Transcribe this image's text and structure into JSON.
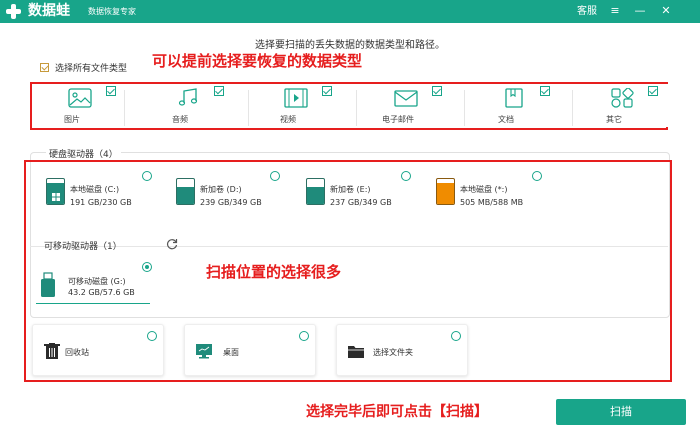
{
  "titlebar": {
    "app_name": "数据蛙",
    "subtitle": "数据恢复专家",
    "support": "客服",
    "menu_icon": "≡",
    "minimize_icon": "—",
    "close_icon": "✕",
    "color": "#18a58a"
  },
  "instruction": "选择要扫描的丢失数据的数据类型和路径。",
  "select_all": {
    "label": "选择所有文件类型",
    "checked": true
  },
  "annotations": {
    "types_hint": "可以提前选择要恢复的数据类型",
    "locations_hint": "扫描位置的选择很多",
    "scan_hint": "选择完毕后即可点击【扫描】",
    "color": "#e61e1e"
  },
  "file_types": [
    {
      "label": "图片",
      "icon": "image-icon",
      "checked": true
    },
    {
      "label": "音频",
      "icon": "music-icon",
      "checked": true
    },
    {
      "label": "视频",
      "icon": "video-icon",
      "checked": true
    },
    {
      "label": "电子邮件",
      "icon": "email-icon",
      "checked": true
    },
    {
      "label": "文档",
      "icon": "document-icon",
      "checked": true
    },
    {
      "label": "其它",
      "icon": "other-icon",
      "checked": true
    }
  ],
  "hard_drives": {
    "title": "硬盘驱动器（4）",
    "items": [
      {
        "name": "本地磁盘 (C:)",
        "size": "191 GB/230 GB",
        "usage": 0.83,
        "color": "#1f8b7b",
        "has_windows": true,
        "selected": false
      },
      {
        "name": "新加卷 (D:)",
        "size": "239 GB/349 GB",
        "usage": 0.68,
        "color": "#1f8b7b",
        "selected": false
      },
      {
        "name": "新加卷 (E:)",
        "size": "237 GB/349 GB",
        "usage": 0.68,
        "color": "#1f8b7b",
        "selected": false
      },
      {
        "name": "本地磁盘 (*:)",
        "size": "505 MB/588 MB",
        "usage": 0.86,
        "color": "#f08c00",
        "selected": false
      }
    ]
  },
  "removable": {
    "title": "可移动驱动器（1）",
    "items": [
      {
        "name": "可移动磁盘 (G:)",
        "size": "43.2 GB/57.6 GB",
        "selected": true
      }
    ]
  },
  "locations": [
    {
      "label": "回收站",
      "icon": "recycle-bin-icon",
      "selected": false
    },
    {
      "label": "桌面",
      "icon": "desktop-icon",
      "selected": false
    },
    {
      "label": "选择文件夹",
      "icon": "folder-icon",
      "selected": false
    }
  ],
  "scan_button": "扫描"
}
